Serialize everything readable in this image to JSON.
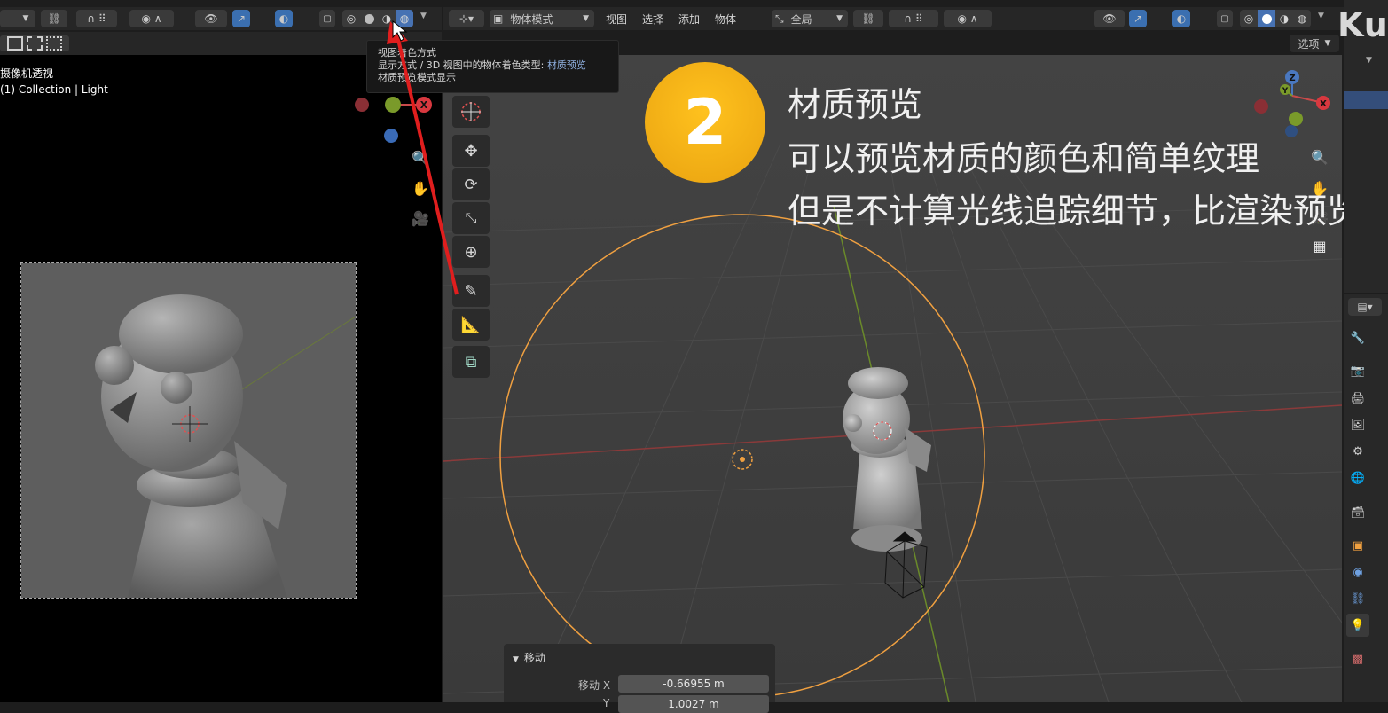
{
  "left_header": {
    "segment_icons": [
      "frame-icon",
      "frame-icon",
      "frame-icon"
    ]
  },
  "left_viewport": {
    "view_name": "摄像机透视",
    "collection_label": "(1) Collection | Light"
  },
  "main_header": {
    "mode_label": "物体模式",
    "menu": [
      "视图",
      "选择",
      "添加",
      "物体"
    ],
    "transform_orientation": "全局",
    "options_label": "选项"
  },
  "tooltip": {
    "title": "视图着色方式",
    "description_prefix": "显示方式 / 3D 视图中的物体着色类型: ",
    "description_value": "材质预览",
    "footer": "材质预览模式显示"
  },
  "overlay": {
    "step_number": "2",
    "title": "材质预览",
    "line1": "可以预览材质的颜色和简单纹理",
    "line2": "但是不计算光线追踪细节，比渲染预览快",
    "logo_text": "Ku"
  },
  "operator_panel": {
    "title": "移动",
    "field_label": "移动 X",
    "x_value": "-0.66955 m",
    "y_label": "Y",
    "y_value": "1.0027 m"
  },
  "gizmo": {
    "z": "Z",
    "y": "Y",
    "x": "X"
  },
  "colors": {
    "accent": "#4772b3",
    "selection_orange": "#f0a040",
    "annotation_red": "#e01e1e",
    "badge_yellow": "#f2a81d"
  }
}
